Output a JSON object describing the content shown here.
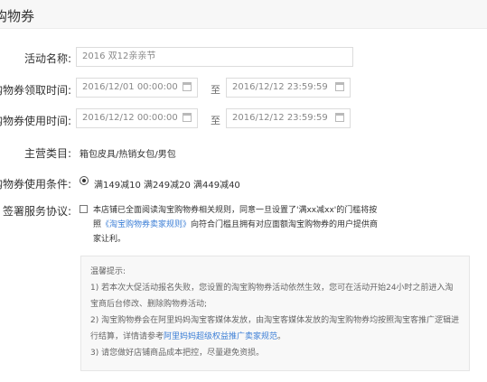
{
  "page": {
    "title": "购物券"
  },
  "form": {
    "activity_name": {
      "label": "活动名称:",
      "value": "2016 双12亲亲节"
    },
    "receive_time": {
      "label": "购物券领取时间:",
      "start": "2016/12/01 00:00:00",
      "separator": "至",
      "end": "2016/12/12 23:59:59"
    },
    "use_time": {
      "label": "购物券使用时间:",
      "start": "2016/12/12 00:00:00",
      "separator": "至",
      "end": "2016/12/12 23:59:59"
    },
    "category": {
      "label": "主营类目:",
      "value": "箱包皮具/热销女包/男包"
    },
    "use_condition": {
      "label": "购物券使用条件:",
      "option": "满149减10 满249减20 满449减40",
      "selected": true
    },
    "agreement": {
      "label": "签署服务协议:",
      "checked": false,
      "text_1": "本店铺已全面阅读淘宝购物券相关规则，同意一旦设置了'满xx减xx'的门槛将按照",
      "link": "《淘宝购物券卖家规则》",
      "text_2": "向符合门槛且拥有对应面额淘宝购物券的用户提供商家让利。"
    }
  },
  "tips": {
    "title": "温馨提示:",
    "item_1": "1) 若本次大促活动报名失败，您设置的淘宝购物券活动依然生效，您可在活动开始24小时之前进入淘宝商后台修改、删除购物券活动;",
    "item_2_before": "2) 淘宝购物券会在阿里妈妈淘宝客媒体发放，由淘宝客媒体发放的淘宝购物券均按照淘宝客推广逻辑进行结算，详情请参考",
    "item_2_link": "阿里妈妈超级权益推广卖家规范",
    "item_2_after": "。",
    "item_3": "3) 请您做好店铺商品成本把控，尽量避免资损。"
  },
  "icons": {
    "date_picker": "calendar-icon"
  }
}
